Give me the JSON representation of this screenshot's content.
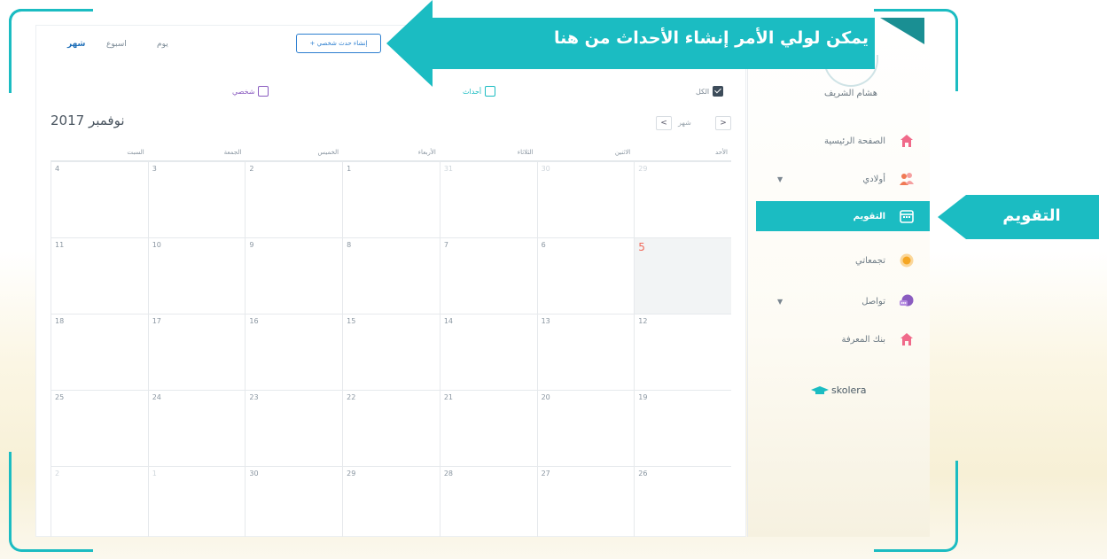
{
  "callouts": {
    "create_events": "يمكن لولي الأمر إنشاء الأحداث من هنا",
    "calendar": "التقويم"
  },
  "toolbar": {
    "tabs": [
      "شهر",
      "اسبوع",
      "يوم"
    ],
    "active_tab": "شهر",
    "create_button": "+ إنشاء حدث شخصي"
  },
  "filters": {
    "all": "الكل",
    "events": "أحداث",
    "personal": "شخصي"
  },
  "calendar": {
    "month_title": "نوفمبر 2017",
    "nav_prev": "<",
    "nav_next": ">",
    "nav_label": "شهر",
    "weekdays": [
      "الأحد",
      "الاثنين",
      "الثلاثاء",
      "الأربعاء",
      "الخميس",
      "الجمعة",
      "السبت"
    ],
    "weeks": [
      [
        "29",
        "30",
        "31",
        "1",
        "2",
        "3",
        "4"
      ],
      [
        "5",
        "6",
        "7",
        "8",
        "9",
        "10",
        "11"
      ],
      [
        "12",
        "13",
        "14",
        "15",
        "16",
        "17",
        "18"
      ],
      [
        "19",
        "20",
        "21",
        "22",
        "23",
        "24",
        "25"
      ],
      [
        "26",
        "27",
        "28",
        "29",
        "30",
        "1",
        "2"
      ]
    ],
    "today": "5"
  },
  "sidebar": {
    "user_name": "هشام الشريف",
    "items": [
      {
        "label": "الصفحة الرئيسية",
        "icon": "home-icon",
        "color": "#f06a8a"
      },
      {
        "label": "أولادي",
        "icon": "children-icon",
        "color": "#f07a55"
      },
      {
        "label": "التقويم",
        "icon": "calendar-icon",
        "color": "#ffffff"
      },
      {
        "label": "تجمعاتي",
        "icon": "groups-icon",
        "color": "#f5a623"
      },
      {
        "label": "تواصل",
        "icon": "chat-icon",
        "color": "#8a5cc0"
      },
      {
        "label": "بنك المعرفة",
        "icon": "knowledge-bank-icon",
        "color": "#f06a8a"
      }
    ],
    "brand": "skolera"
  },
  "colors": {
    "accent": "#1bbcc2",
    "today": "#f06a5b"
  }
}
